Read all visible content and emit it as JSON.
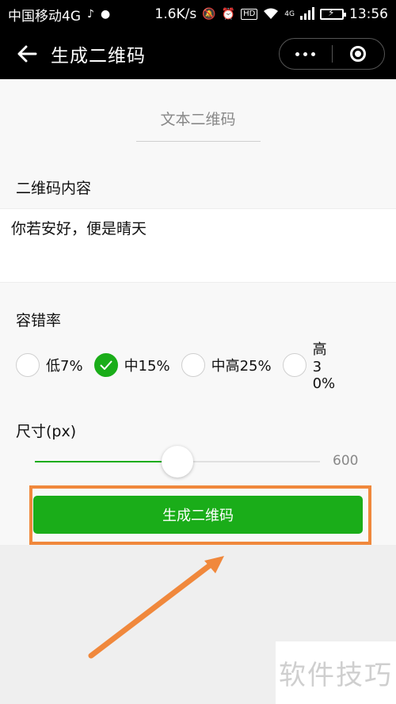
{
  "status_bar": {
    "carrier": "中国移动4G",
    "speed": "1.6K/s",
    "network_badge": "4G",
    "hd_badge": "HD",
    "time": "13:56"
  },
  "title_bar": {
    "title": "生成二维码"
  },
  "tab": {
    "label": "文本二维码"
  },
  "content_section": {
    "label": "二维码内容",
    "value": "你若安好，便是晴天"
  },
  "error_correction": {
    "label": "容错率",
    "options": [
      {
        "label": "低7%",
        "checked": false
      },
      {
        "label": "中15%",
        "checked": true
      },
      {
        "label": "中高25%",
        "checked": false
      },
      {
        "label": "高30%",
        "checked": false
      }
    ]
  },
  "size": {
    "label": "尺寸(px)",
    "value": "600",
    "fraction": 0.5
  },
  "generate_button": {
    "label": "生成二维码"
  },
  "colors": {
    "accent": "#1aad19",
    "highlight": "#f0883c"
  },
  "watermark": {
    "text": "软件技巧"
  }
}
